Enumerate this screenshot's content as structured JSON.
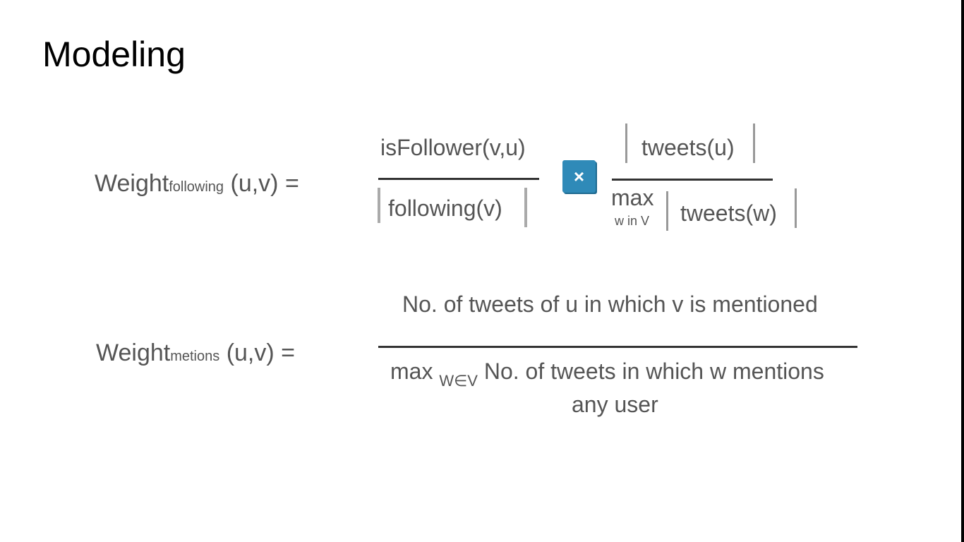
{
  "slide": {
    "title": "Modeling"
  },
  "equation1": {
    "lhs_main": "Weight",
    "lhs_sub": "following",
    "lhs_rest": " (u,v) =",
    "frac1_numerator": "isFollower(v,u)",
    "frac1_denominator": "following(v)",
    "times_symbol": "×",
    "frac2_numerator": "tweets(u)",
    "frac2_max": "max",
    "frac2_max_sub": "w in V",
    "frac2_denominator": "tweets(w)"
  },
  "equation2": {
    "lhs_main": "Weight",
    "lhs_sub": "metions",
    "lhs_rest": " (u,v) =",
    "numerator": "No. of tweets of u in which v is mentioned",
    "den_max": "max ",
    "den_sub": "W∈V",
    "den_rest": " No. of tweets in which w mentions",
    "den_line2": "any user"
  },
  "colors": {
    "text": "#555555",
    "title": "#000000",
    "times_button": "#2f8ab8"
  }
}
